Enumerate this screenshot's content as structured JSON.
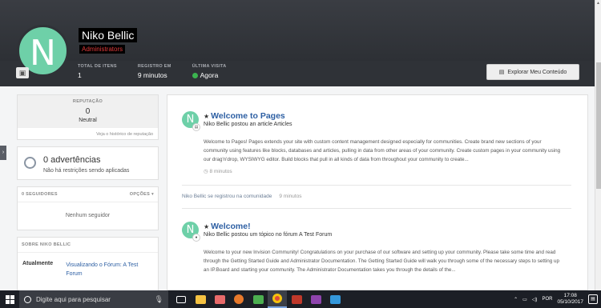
{
  "profile": {
    "avatar_letter": "N",
    "name": "Niko Bellic",
    "role": "Administrators",
    "stats": [
      {
        "label": "TOTAL DE ITENS",
        "value": "1"
      },
      {
        "label": "REGISTRO EM",
        "value": "9 minutos"
      },
      {
        "label": "ÚLTIMA VISITA",
        "value": "Agora"
      }
    ],
    "explore_button": "Explorar Meu Conteúdo"
  },
  "sidebar": {
    "reputation": {
      "label": "REPUTAÇÃO",
      "value": "0",
      "level": "Neutral",
      "link": "Veja o histórico de reputação"
    },
    "warnings": {
      "title": "0 advertências",
      "subtitle": "Não há restrições sendo aplicadas"
    },
    "followers": {
      "title": "0 SEGUIDORES",
      "options": "OPÇÕES",
      "empty": "Nenhum seguidor"
    },
    "about": {
      "title": "SOBRE NIKO BELLIC",
      "key": "Atualmente",
      "value": "Visualizando o Fórum: A Test Forum"
    }
  },
  "feed": {
    "items": [
      {
        "avatar_letter": "N",
        "title": "Welcome to Pages",
        "subtitle": "Niko Bellic postou an article Articles",
        "text": "Welcome to Pages! Pages extends your site with custom content management designed especially for communities. Create brand new sections of your community using features like blocks, databases and articles, pulling in data from other areas of your community. Create custom pages in your community using our drag'n'drop, WYSIWYG editor. Build blocks that pull in all kinds of data from throughout your community to create...",
        "time": "8 minutos"
      },
      {
        "avatar_letter": "N",
        "title": "Welcome!",
        "subtitle": "Niko Bellic postou um tópico no fórum A Test Forum",
        "text": "Welcome to your new Invision Community! Congratulations on your purchase of our software and setting up your community. Please take some time and read through the Getting Started Guide and Administrator Documentation. The Getting Started Guide will walk you through some of the necessary steps to setting up an IP.Board and starting your community. The Administrator Documentation takes you through the details of the..."
      }
    ],
    "registration": {
      "text": "Niko Bellic se registrou na comunidade",
      "time": "9 minutos"
    }
  },
  "taskbar": {
    "search_placeholder": "Digite aqui para pesquisar",
    "language": "POR",
    "time": "17:08",
    "date": "05/10/2017"
  }
}
